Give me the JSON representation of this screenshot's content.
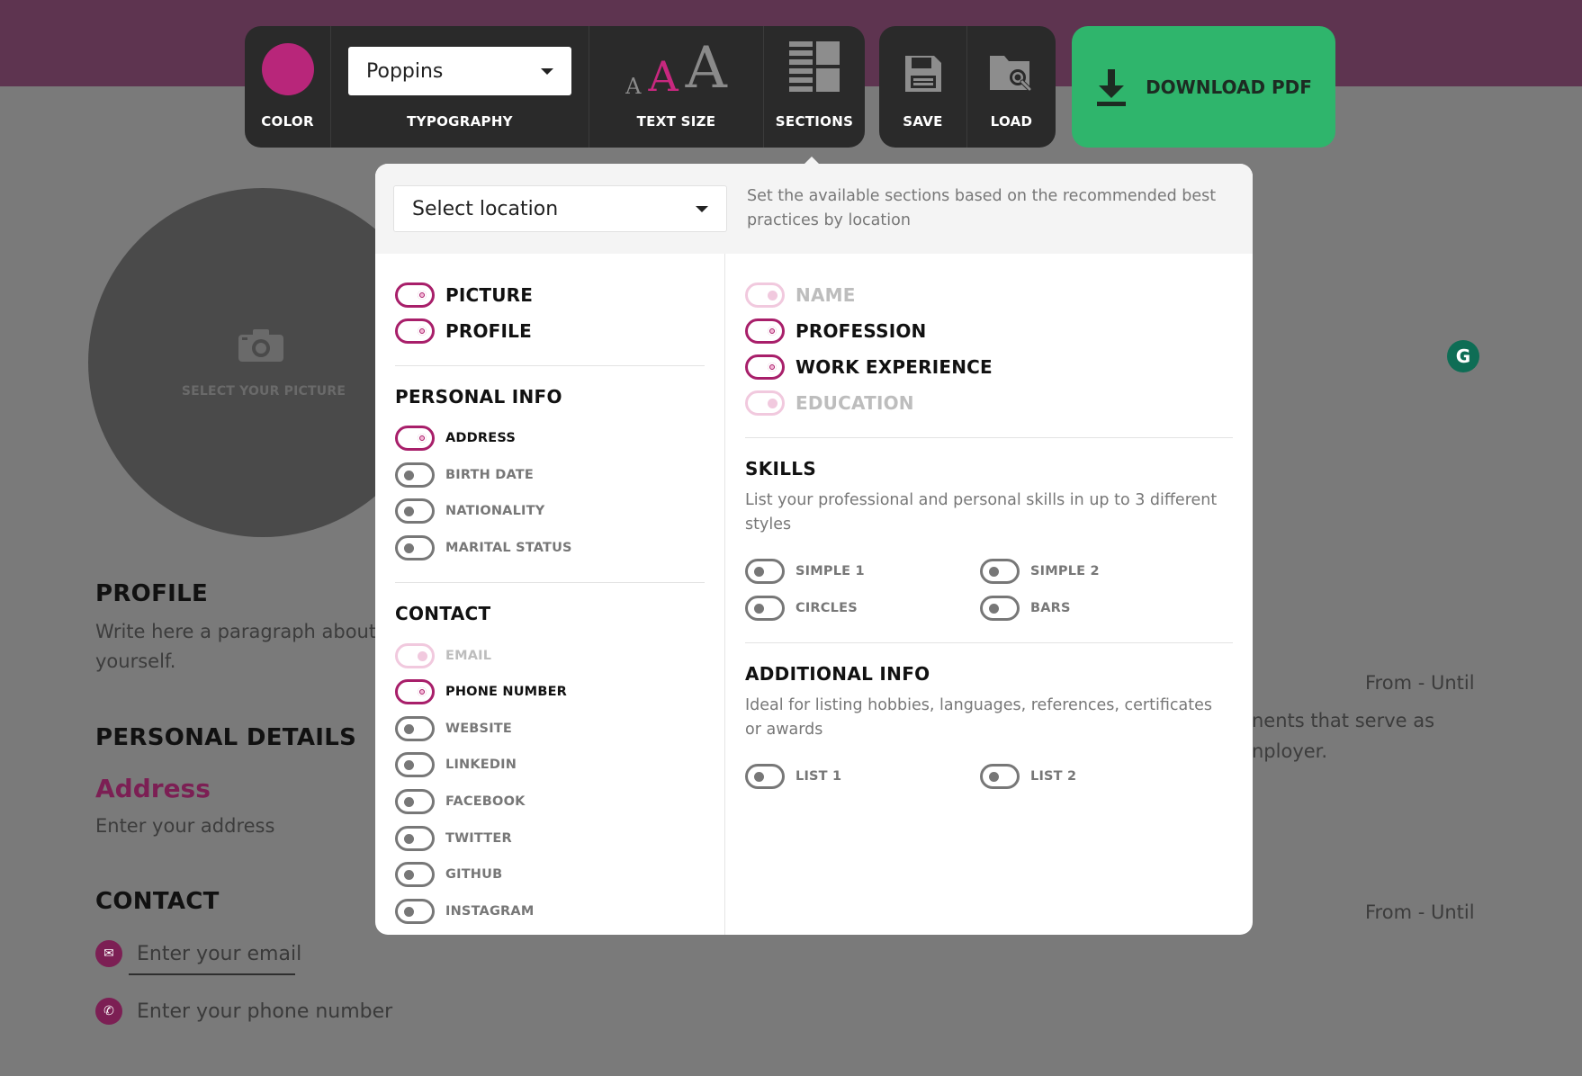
{
  "colors": {
    "accent": "#a81f6a",
    "swatch": "#b8267a",
    "download": "#2fb56c",
    "toolbar": "#2a2a2a"
  },
  "toolbar": {
    "color_label": "COLOR",
    "typography_label": "TYPOGRAPHY",
    "font_value": "Poppins",
    "text_size_label": "TEXT SIZE",
    "size_glyph": "A",
    "sections_label": "SECTIONS",
    "save_label": "SAVE",
    "load_label": "LOAD",
    "download_label": "DOWNLOAD PDF"
  },
  "panel": {
    "location_placeholder": "Select location",
    "location_description": "Set the available sections based on the recommended best practices by location",
    "left": {
      "main": [
        {
          "label": "PICTURE",
          "state": "on"
        },
        {
          "label": "PROFILE",
          "state": "on"
        }
      ],
      "personal_info_title": "PERSONAL INFO",
      "personal_info": [
        {
          "label": "ADDRESS",
          "state": "on"
        },
        {
          "label": "BIRTH DATE",
          "state": "off"
        },
        {
          "label": "NATIONALITY",
          "state": "off"
        },
        {
          "label": "MARITAL STATUS",
          "state": "off"
        }
      ],
      "contact_title": "CONTACT",
      "contact": [
        {
          "label": "EMAIL",
          "state": "disabled"
        },
        {
          "label": "PHONE NUMBER",
          "state": "on"
        },
        {
          "label": "WEBSITE",
          "state": "off"
        },
        {
          "label": "LINKEDIN",
          "state": "off"
        },
        {
          "label": "FACEBOOK",
          "state": "off"
        },
        {
          "label": "TWITTER",
          "state": "off"
        },
        {
          "label": "GITHUB",
          "state": "off"
        },
        {
          "label": "INSTAGRAM",
          "state": "off"
        }
      ]
    },
    "right": {
      "main": [
        {
          "label": "NAME",
          "state": "disabled"
        },
        {
          "label": "PROFESSION",
          "state": "on"
        },
        {
          "label": "WORK EXPERIENCE",
          "state": "on"
        },
        {
          "label": "EDUCATION",
          "state": "disabled"
        }
      ],
      "skills_title": "SKILLS",
      "skills_desc": "List your professional and personal skills in up to 3 different styles",
      "skills": [
        {
          "label": "SIMPLE 1",
          "state": "off"
        },
        {
          "label": "SIMPLE 2",
          "state": "off"
        },
        {
          "label": "CIRCLES",
          "state": "off"
        },
        {
          "label": "BARS",
          "state": "off"
        }
      ],
      "additional_title": "ADDITIONAL INFO",
      "additional_desc": "Ideal for listing hobbies, languages, references, certificates or awards",
      "additional": [
        {
          "label": "LIST 1",
          "state": "off"
        },
        {
          "label": "LIST 2",
          "state": "off"
        }
      ]
    }
  },
  "resume": {
    "picture_label": "SELECT YOUR PICTURE",
    "profile_title": "PROFILE",
    "profile_text_1": "Write here a paragraph about",
    "profile_text_2": "yourself.",
    "personal_details_title": "PERSONAL DETAILS",
    "address_label": "Address",
    "address_placeholder": "Enter your address",
    "contact_title": "CONTACT",
    "email_placeholder": "Enter your email",
    "phone_placeholder": "Enter your phone number",
    "date_range_1": "From - Until",
    "date_range_2": "From - Until",
    "work_text_1": "nents that serve as",
    "work_text_2": "nployer."
  }
}
